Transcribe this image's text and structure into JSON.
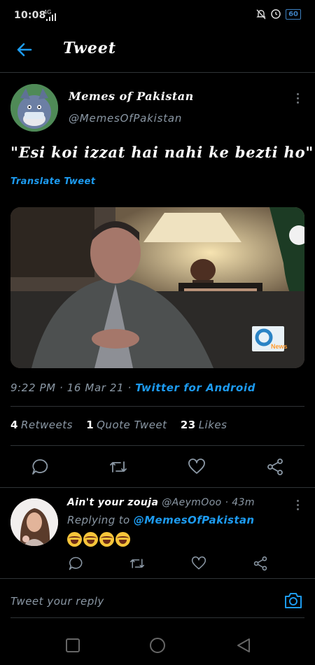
{
  "status_bar": {
    "time": "10:08",
    "network": "4G",
    "battery": "60"
  },
  "header": {
    "title": "Tweet"
  },
  "tweet": {
    "author_name": "Memes of Pakistan",
    "author_handle": "@MemesOfPakistan",
    "text": "\"Esi koi izzat hai nahi ke bezti ho\"",
    "translate_label": "Translate Tweet",
    "time": "9:22 PM",
    "date": "16 Mar 21",
    "source": "Twitter for Android",
    "retweets_count": "4",
    "retweets_label": "Retweets",
    "quote_count": "1",
    "quote_label": "Quote Tweet",
    "likes_count": "23",
    "likes_label": "Likes",
    "media_watermark": "News"
  },
  "reply": {
    "author_name": "Ain't your zouja",
    "author_handle": "@AeymOoo",
    "age": "43m",
    "replying_to_label": "Replying to",
    "replying_to_handle": "@MemesOfPakistan",
    "emojis": [
      "laughing-tears-emoji",
      "laughing-tears-emoji",
      "laughing-tears-emoji",
      "laughing-tears-emoji"
    ]
  },
  "composer": {
    "placeholder": "Tweet your reply"
  },
  "icons": {
    "back": "back-arrow-icon",
    "reply": "reply-icon",
    "retweet": "retweet-icon",
    "like": "heart-icon",
    "share": "share-icon",
    "camera": "camera-icon"
  },
  "colors": {
    "accent": "#1d9bf0",
    "background": "#000000",
    "secondary_text": "#8b98a5",
    "divider": "#2f3336"
  }
}
